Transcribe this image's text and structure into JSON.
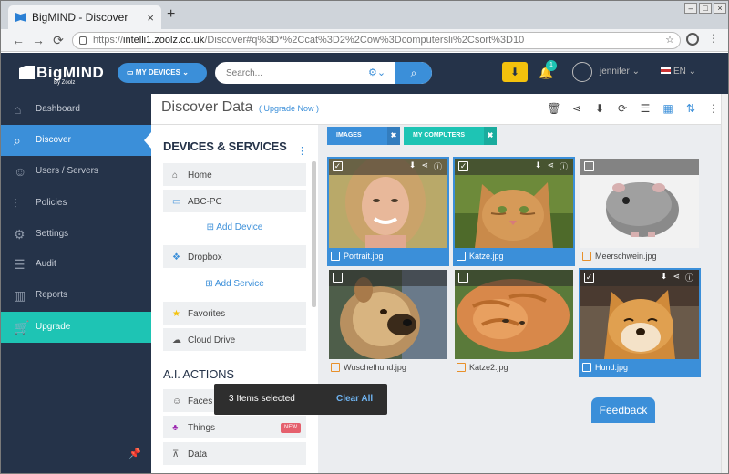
{
  "browser": {
    "tab_title": "BigMIND - Discover",
    "new_tab": "+",
    "url_scheme": "https://",
    "url_host": "intelli1.zoolz.co.uk",
    "url_path": "/Discover#q%3D*%2Ccat%3D2%2Cow%3Dcomputersli%2Csort%3D10"
  },
  "topbar": {
    "logo": "BigMIND",
    "logo_sub": "By Zoolz",
    "my_devices": "MY DEVICES",
    "search_placeholder": "Search...",
    "notification_count": "1",
    "user_name": "jennifer",
    "language": "EN",
    "accent_color": "#3b8fd9",
    "upgrade_color": "#1ec4b4"
  },
  "sidebar": {
    "items": [
      {
        "label": "Dashboard",
        "icon": "home-icon"
      },
      {
        "label": "Discover",
        "icon": "search-icon"
      },
      {
        "label": "Users / Servers",
        "icon": "users-icon"
      },
      {
        "label": "Policies",
        "icon": "sliders-icon"
      },
      {
        "label": "Settings",
        "icon": "gear-icon"
      },
      {
        "label": "Audit",
        "icon": "list-icon"
      },
      {
        "label": "Reports",
        "icon": "bar-chart-icon"
      },
      {
        "label": "Upgrade",
        "icon": "cart-icon"
      }
    ]
  },
  "page": {
    "title": "Discover Data",
    "upgrade_link": "( Upgrade Now )"
  },
  "panel": {
    "devices_heading": "DEVICES & SERVICES",
    "home": "Home",
    "abc_pc": "ABC-PC",
    "add_device": "Add Device",
    "dropbox": "Dropbox",
    "add_service": "Add Service",
    "favorites": "Favorites",
    "cloud_drive": "Cloud Drive",
    "ai_heading": "A.I. ACTIONS",
    "faces": "Faces",
    "things": "Things",
    "data": "Data",
    "new_badge": "NEW"
  },
  "filters": [
    {
      "label": "IMAGES",
      "remove": "✖"
    },
    {
      "label": "MY COMPUTERS",
      "remove": "✖"
    }
  ],
  "files": [
    {
      "name": "Portrait.jpg",
      "selected": true
    },
    {
      "name": "Katze.jpg",
      "selected": true
    },
    {
      "name": "Meerschwein.jpg",
      "selected": false
    },
    {
      "name": "Wuschelhund.jpg",
      "selected": false
    },
    {
      "name": "Katze2.jpg",
      "selected": false
    },
    {
      "name": "Hund.jpg",
      "selected": true
    }
  ],
  "toast": {
    "text": "3 Items selected",
    "clear": "Clear All"
  },
  "feedback": "Feedback"
}
